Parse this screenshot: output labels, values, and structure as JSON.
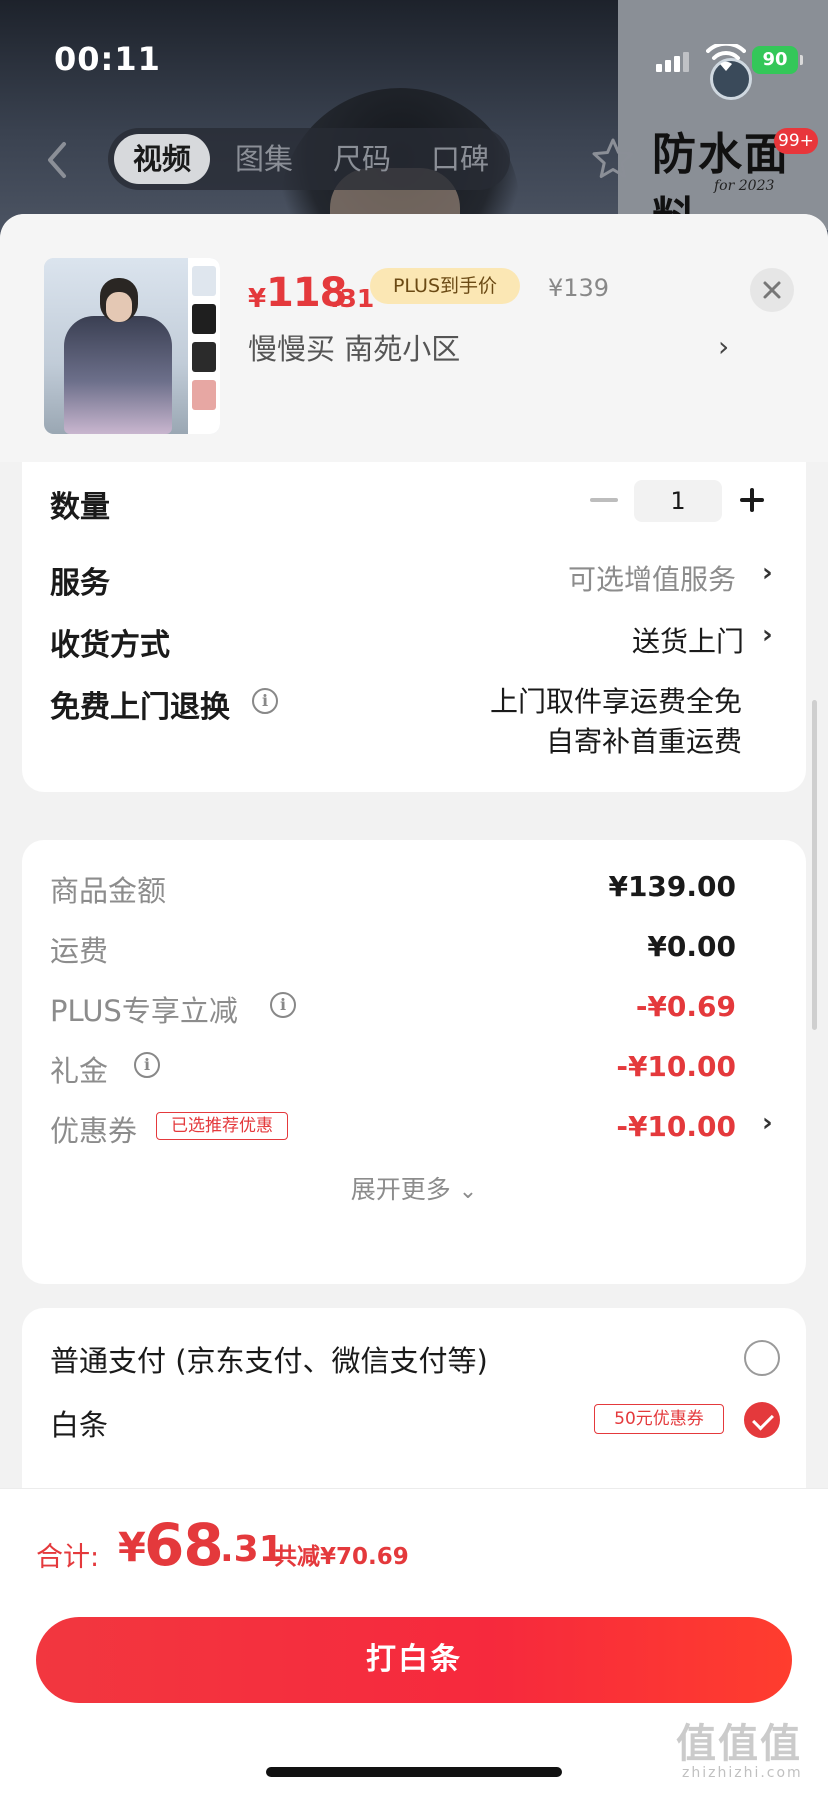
{
  "status_bar": {
    "time": "00:11",
    "battery": "90"
  },
  "background": {
    "tabs": [
      "视频",
      "图集",
      "尺码",
      "口碑"
    ],
    "active_tab_index": 0,
    "badge": "99+",
    "thumb_title": "防水面料",
    "thumb_subtitle": "for 2023"
  },
  "header": {
    "price_currency": "¥",
    "price_int": "118",
    "price_dec": ".31",
    "plus_tag": "PLUS到手价",
    "original_price": "¥139",
    "address": "慢慢买  南苑小区"
  },
  "options": {
    "quantity_label": "数量",
    "quantity_value": "1",
    "service_label": "服务",
    "service_value": "可选增值服务",
    "delivery_label": "收货方式",
    "delivery_value": "送货上门",
    "return_label": "免费上门退换",
    "return_line1": "上门取件享运费全免",
    "return_line2": "自寄补首重运费"
  },
  "fees": {
    "goods_label": "商品金额",
    "goods_value": "¥139.00",
    "shipping_label": "运费",
    "shipping_value": "¥0.00",
    "plus_label": "PLUS专享立减",
    "plus_value": "-¥0.69",
    "gift_label": "礼金",
    "gift_value": "-¥10.00",
    "coupon_label": "优惠券",
    "coupon_tag": "已选推荐优惠",
    "coupon_value": "-¥10.00",
    "expand_label": "展开更多"
  },
  "payment": {
    "normal_label": "普通支付 (京东支付、微信支付等)",
    "baitiao_label": "白条",
    "baitiao_tag": "50元优惠券",
    "selected": "baitiao"
  },
  "footer": {
    "total_label": "合计:",
    "total_currency": "¥",
    "total_int": "68",
    "total_dec": ".31",
    "saved": "共减¥70.69",
    "button_label": "打白条",
    "watermark": "值值值",
    "watermark_sub": "zhizhizhi.com"
  },
  "colors": {
    "accent": "#e4393c",
    "plus_tag_bg": "#fbe7b4",
    "success": "#34c759"
  }
}
